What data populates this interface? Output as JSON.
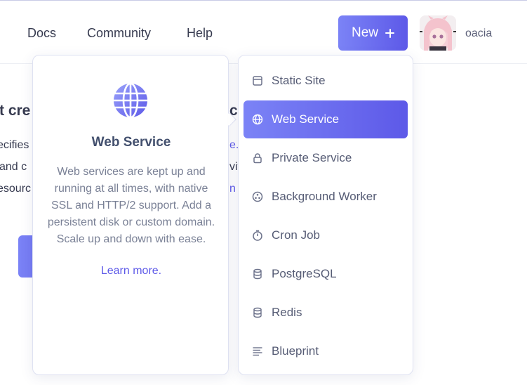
{
  "nav": {
    "docs": "Docs",
    "community": "Community",
    "help": "Help",
    "new_button": "New",
    "username": "oacia"
  },
  "background": {
    "heading_left": "'t cre",
    "heading_right": "ce",
    "line1_left": "ecifies",
    "line1_right": "e.",
    "line2_left": "and c",
    "line2_right": "vit",
    "line3_left": "esourc",
    "line3_right": "n"
  },
  "description": {
    "title": "Web Service",
    "body": "Web services are kept up and running at all times, with native SSL and HTTP/2 support. Add a persistent disk or custom domain. Scale up and down with ease.",
    "link": "Learn more.",
    "icon": "globe-icon"
  },
  "menu": {
    "items": [
      {
        "label": "Static Site",
        "icon": "browser-window-icon"
      },
      {
        "label": "Web Service",
        "icon": "globe-icon"
      },
      {
        "label": "Private Service",
        "icon": "lock-icon"
      },
      {
        "label": "Background Worker",
        "icon": "worker-icon"
      },
      {
        "label": "Cron Job",
        "icon": "stopwatch-icon"
      },
      {
        "label": "PostgreSQL",
        "icon": "database-icon"
      },
      {
        "label": "Redis",
        "icon": "database-icon"
      },
      {
        "label": "Blueprint",
        "icon": "blueprint-lines-icon"
      }
    ],
    "active_index": 1
  },
  "colors": {
    "accent_start": "#7b83f6",
    "accent_end": "#5d59e8",
    "text": "#363a4f",
    "muted": "#7a8196"
  }
}
